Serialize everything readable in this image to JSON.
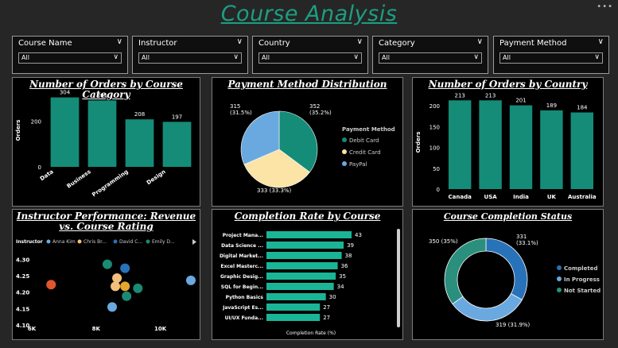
{
  "title": "Course Analysis",
  "slicers": [
    {
      "label": "Course Name",
      "value": "All"
    },
    {
      "label": "Instructor",
      "value": "All"
    },
    {
      "label": "Country",
      "value": "All"
    },
    {
      "label": "Category",
      "value": "All"
    },
    {
      "label": "Payment Method",
      "value": "All"
    }
  ],
  "colors": {
    "teal": "#148c78",
    "tealBright": "#1ab596",
    "beige": "#fce3a6",
    "blue": "#6aa9e0",
    "darkBlue": "#2872b9",
    "bg": "#262626"
  },
  "chart_data": [
    {
      "id": "category",
      "type": "bar",
      "title": "Number of Orders by Course Category",
      "ylabel": "Orders",
      "categories": [
        "Data",
        "Business",
        "Programming",
        "Design"
      ],
      "values": [
        304,
        291,
        208,
        197
      ],
      "ylim": [
        0,
        320
      ],
      "yticks": [
        "0",
        "200"
      ]
    },
    {
      "id": "payment",
      "type": "pie",
      "title": "Payment Method Distribution",
      "legend_title": "Payment Method",
      "labels": [
        "Debit Card",
        "Credit Card",
        "PayPal"
      ],
      "values": [
        352,
        333,
        315
      ],
      "percent_labels": [
        "352\n(35.2%)",
        "333 (33.3%)",
        "315\n(31.5%)"
      ]
    },
    {
      "id": "country",
      "type": "bar",
      "title": "Number of Orders by Country",
      "ylabel": "Orders",
      "categories": [
        "Canada",
        "USA",
        "India",
        "UK",
        "Australia"
      ],
      "values": [
        213,
        213,
        201,
        189,
        184
      ],
      "ylim": [
        0,
        225
      ],
      "yticks": [
        "0",
        "50",
        "100",
        "150",
        "200"
      ]
    },
    {
      "id": "instructor",
      "type": "scatter",
      "title": "Instructor Performance: Revenue vs. Course Rating",
      "legend_title": "Instructor",
      "legend": [
        "Anna Kim",
        "Chris Br...",
        "David C...",
        "Emily D..."
      ],
      "xticks": [
        "6K",
        "8K",
        "10K"
      ],
      "yticks": [
        "4.10",
        "4.15",
        "4.20",
        "4.25",
        "4.30"
      ],
      "xlim": [
        6000,
        11000
      ],
      "ylim": [
        4.1,
        4.32
      ],
      "points": [
        {
          "x": 6600,
          "y": 4.225,
          "color": "#e2562e"
        },
        {
          "x": 8350,
          "y": 4.287,
          "color": "#1a8a73"
        },
        {
          "x": 8900,
          "y": 4.275,
          "color": "#2872b9"
        },
        {
          "x": 8650,
          "y": 4.245,
          "color": "#f1c07a"
        },
        {
          "x": 8600,
          "y": 4.22,
          "color": "#f1c07a"
        },
        {
          "x": 8900,
          "y": 4.22,
          "color": "#e8a52b"
        },
        {
          "x": 9300,
          "y": 4.214,
          "color": "#1a8a73"
        },
        {
          "x": 8500,
          "y": 4.157,
          "color": "#6aa9e0"
        },
        {
          "x": 8950,
          "y": 4.19,
          "color": "#1a8a73"
        },
        {
          "x": 10950,
          "y": 4.238,
          "color": "#6aa9e0"
        }
      ]
    },
    {
      "id": "completion",
      "type": "bar",
      "orientation": "horizontal",
      "title": "Completion Rate by Course",
      "xlabel": "Completion Rate (%)",
      "categories": [
        "Project Mana...",
        "Data Science ...",
        "Digital Market...",
        "Excel Masterc...",
        "Graphic Desig...",
        "SQL for Begin...",
        "Python Basics",
        "JavaScript Es...",
        "UI/UX Funda..."
      ],
      "values": [
        43,
        39,
        38,
        36,
        35,
        34,
        30,
        27,
        27
      ],
      "xlim": [
        0,
        45
      ]
    },
    {
      "id": "status",
      "type": "pie",
      "subtype": "donut",
      "title": "Course Completion Status",
      "labels": [
        "Completed",
        "In Progress",
        "Not Started"
      ],
      "values": [
        331,
        319,
        350
      ],
      "value_labels": [
        "331\n(33.1%)",
        "319 (31.9%)",
        "350 (35%)"
      ],
      "colors": [
        "#2872b9",
        "#6aa9e0",
        "#2a8f7d"
      ]
    }
  ]
}
